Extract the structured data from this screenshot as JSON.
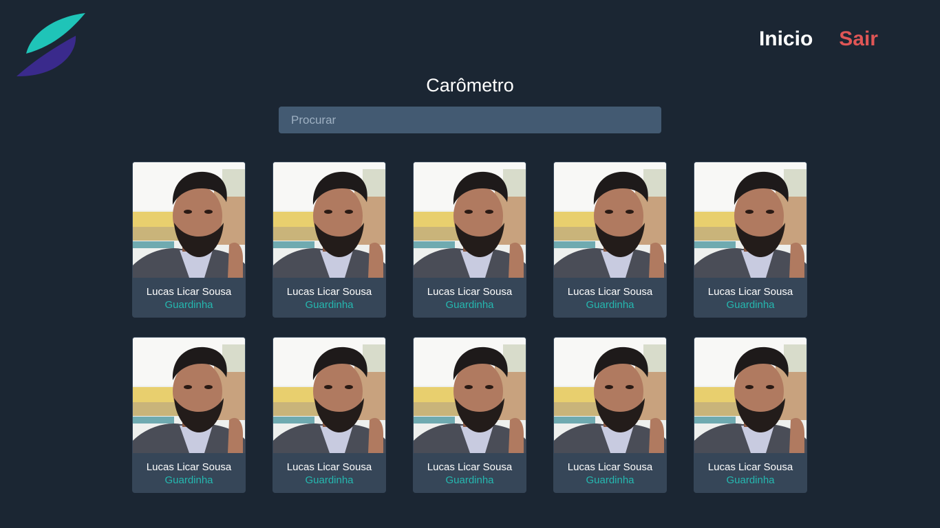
{
  "header": {
    "logo_icon": "brand-s-logo",
    "nav": {
      "inicio_label": "Inicio",
      "sair_label": "Sair"
    }
  },
  "page": {
    "title": "Carômetro"
  },
  "search": {
    "placeholder": "Procurar",
    "value": ""
  },
  "people": [
    {
      "name": "Lucas Licar Sousa",
      "role": "Guardinha"
    },
    {
      "name": "Lucas Licar Sousa",
      "role": "Guardinha"
    },
    {
      "name": "Lucas Licar Sousa",
      "role": "Guardinha"
    },
    {
      "name": "Lucas Licar Sousa",
      "role": "Guardinha"
    },
    {
      "name": "Lucas Licar Sousa",
      "role": "Guardinha"
    },
    {
      "name": "Lucas Licar Sousa",
      "role": "Guardinha"
    },
    {
      "name": "Lucas Licar Sousa",
      "role": "Guardinha"
    },
    {
      "name": "Lucas Licar Sousa",
      "role": "Guardinha"
    },
    {
      "name": "Lucas Licar Sousa",
      "role": "Guardinha"
    },
    {
      "name": "Lucas Licar Sousa",
      "role": "Guardinha"
    }
  ],
  "colors": {
    "background": "#1b2633",
    "card": "#364658",
    "search_bg": "#435a72",
    "accent_teal": "#25b8b0",
    "logout_red": "#e05656",
    "logo_purple": "#3a2a8c"
  }
}
